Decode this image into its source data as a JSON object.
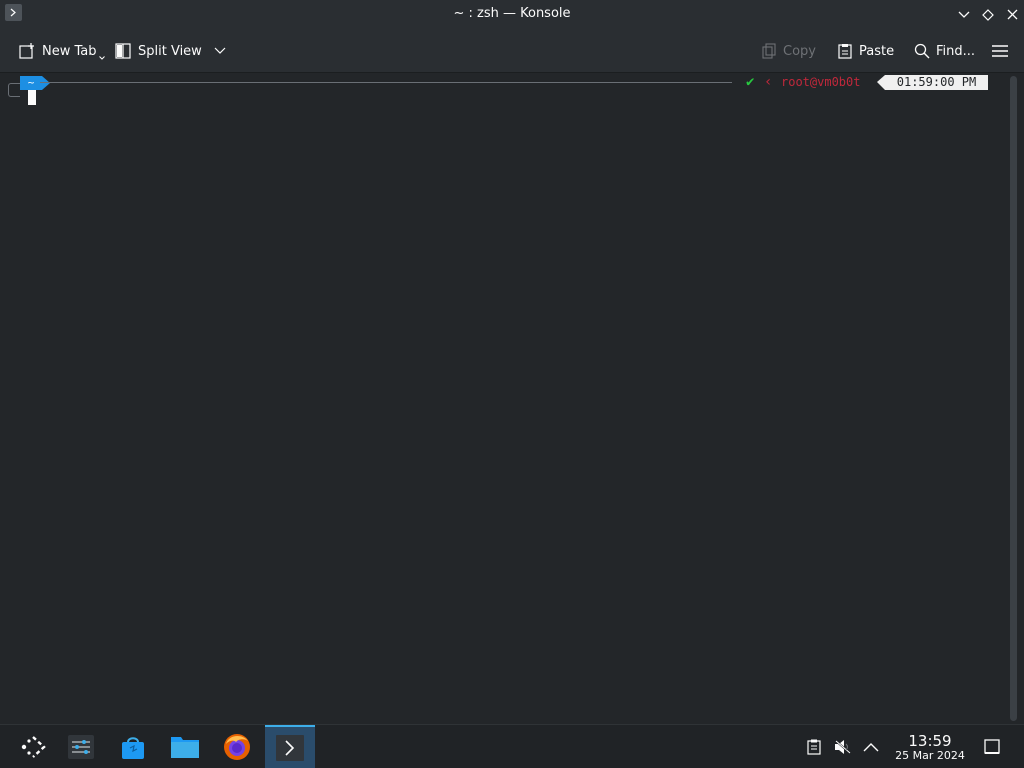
{
  "window": {
    "title": "~ : zsh — Konsole"
  },
  "toolbar": {
    "new_tab": "New Tab",
    "split_view": "Split View",
    "copy": "Copy",
    "paste": "Paste",
    "find": "Find..."
  },
  "terminal": {
    "directory": "~",
    "user_host": "root@vm0b0t",
    "time": "01:59:00 PM",
    "status_check": "✔"
  },
  "taskbar": {
    "clock_time": "13:59",
    "clock_date": "25 Mar 2024",
    "apps": [
      "application-launcher-icon",
      "system-settings-icon",
      "discover-store-icon",
      "file-manager-icon",
      "firefox-icon",
      "konsole-icon"
    ]
  },
  "colors": {
    "accent": "#3daee9",
    "dir_segment": "#1d8fe3",
    "status_ok": "#27c93f",
    "user_host": "#c0283b",
    "background": "#232629"
  }
}
